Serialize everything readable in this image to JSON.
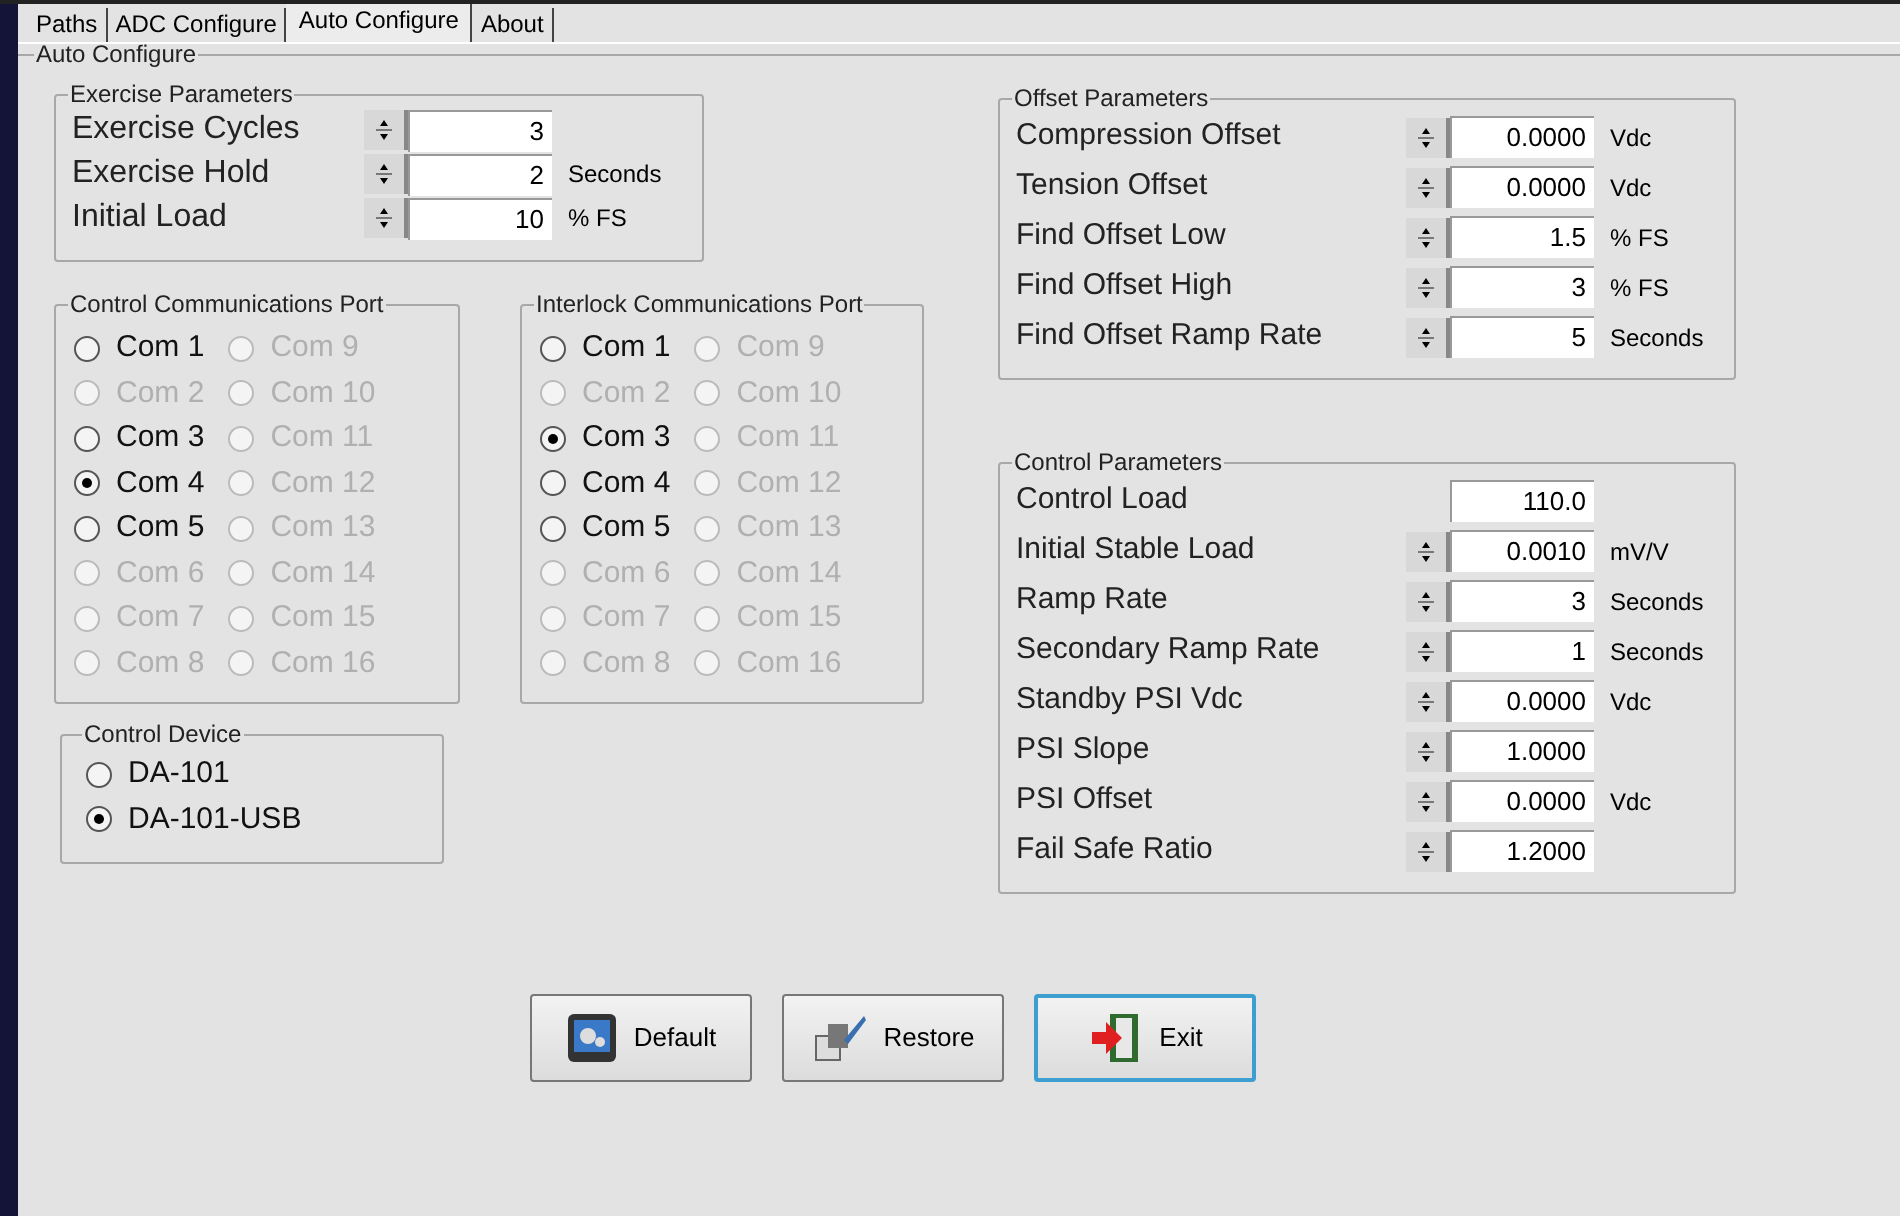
{
  "tabs": [
    {
      "label": "Paths",
      "selected": false
    },
    {
      "label": "ADC Configure",
      "selected": false
    },
    {
      "label": "Auto Configure",
      "selected": true
    },
    {
      "label": "About",
      "selected": false
    }
  ],
  "group_title": "Auto Configure",
  "exercise_parameters": {
    "title": "Exercise Parameters",
    "rows": [
      {
        "label": "Exercise Cycles",
        "value": "3",
        "kind": "spin"
      },
      {
        "label": "Exercise Hold",
        "value": "2",
        "unit": "Seconds",
        "kind": "spin"
      },
      {
        "label": "Initial Load",
        "value": "10",
        "unit": "% FS",
        "kind": "spin"
      }
    ]
  },
  "control_port": {
    "title": "Control Communications Port",
    "options": [
      {
        "label": "Com 1",
        "selected": false,
        "disabled": false
      },
      {
        "label": "Com 2",
        "selected": false,
        "disabled": true
      },
      {
        "label": "Com 3",
        "selected": false,
        "disabled": false
      },
      {
        "label": "Com 4",
        "selected": true,
        "disabled": false
      },
      {
        "label": "Com 5",
        "selected": false,
        "disabled": false
      },
      {
        "label": "Com 6",
        "selected": false,
        "disabled": true
      },
      {
        "label": "Com 7",
        "selected": false,
        "disabled": true
      },
      {
        "label": "Com 8",
        "selected": false,
        "disabled": true
      },
      {
        "label": "Com 9",
        "selected": false,
        "disabled": true
      },
      {
        "label": "Com 10",
        "selected": false,
        "disabled": true
      },
      {
        "label": "Com 11",
        "selected": false,
        "disabled": true
      },
      {
        "label": "Com 12",
        "selected": false,
        "disabled": true
      },
      {
        "label": "Com 13",
        "selected": false,
        "disabled": true
      },
      {
        "label": "Com 14",
        "selected": false,
        "disabled": true
      },
      {
        "label": "Com 15",
        "selected": false,
        "disabled": true
      },
      {
        "label": "Com 16",
        "selected": false,
        "disabled": true
      }
    ]
  },
  "interlock_port": {
    "title": "Interlock Communications Port",
    "options": [
      {
        "label": "Com 1",
        "selected": false,
        "disabled": false
      },
      {
        "label": "Com 2",
        "selected": false,
        "disabled": true
      },
      {
        "label": "Com 3",
        "selected": true,
        "disabled": false
      },
      {
        "label": "Com 4",
        "selected": false,
        "disabled": false
      },
      {
        "label": "Com 5",
        "selected": false,
        "disabled": false
      },
      {
        "label": "Com 6",
        "selected": false,
        "disabled": true
      },
      {
        "label": "Com 7",
        "selected": false,
        "disabled": true
      },
      {
        "label": "Com 8",
        "selected": false,
        "disabled": true
      },
      {
        "label": "Com 9",
        "selected": false,
        "disabled": true
      },
      {
        "label": "Com 10",
        "selected": false,
        "disabled": true
      },
      {
        "label": "Com 11",
        "selected": false,
        "disabled": true
      },
      {
        "label": "Com 12",
        "selected": false,
        "disabled": true
      },
      {
        "label": "Com 13",
        "selected": false,
        "disabled": true
      },
      {
        "label": "Com 14",
        "selected": false,
        "disabled": true
      },
      {
        "label": "Com 15",
        "selected": false,
        "disabled": true
      },
      {
        "label": "Com 16",
        "selected": false,
        "disabled": true
      }
    ]
  },
  "control_device": {
    "title": "Control Device",
    "options": [
      {
        "label": "DA-101",
        "selected": false,
        "disabled": false
      },
      {
        "label": "DA-101-USB",
        "selected": true,
        "disabled": false
      }
    ]
  },
  "offset_parameters": {
    "title": "Offset Parameters",
    "rows": [
      {
        "label": "Compression Offset",
        "value": "0.0000",
        "unit": "Vdc",
        "kind": "spin"
      },
      {
        "label": "Tension Offset",
        "value": "0.0000",
        "unit": "Vdc",
        "kind": "spin"
      },
      {
        "label": "Find Offset Low",
        "value": "1.5",
        "unit": "% FS",
        "kind": "spin"
      },
      {
        "label": "Find Offset High",
        "value": "3",
        "unit": "% FS",
        "kind": "spin"
      },
      {
        "label": "Find Offset Ramp Rate",
        "value": "5",
        "unit": "Seconds",
        "kind": "spin"
      }
    ]
  },
  "control_parameters": {
    "title": "Control Parameters",
    "rows": [
      {
        "label": "Control Load",
        "value": "110.0",
        "kind": "plain"
      },
      {
        "label": "Initial Stable Load",
        "value": "0.0010",
        "unit": "mV/V",
        "kind": "spin"
      },
      {
        "label": "Ramp Rate",
        "value": "3",
        "unit": "Seconds",
        "kind": "spin"
      },
      {
        "label": "Secondary Ramp Rate",
        "value": "1",
        "unit": "Seconds",
        "kind": "spin"
      },
      {
        "label": "Standby PSI Vdc",
        "value": "0.0000",
        "unit": "Vdc",
        "kind": "spin"
      },
      {
        "label": "PSI Slope",
        "value": "1.0000",
        "kind": "spin"
      },
      {
        "label": "PSI Offset",
        "value": "0.0000",
        "unit": "Vdc",
        "kind": "spin"
      },
      {
        "label": "Fail Safe Ratio",
        "value": "1.2000",
        "kind": "spin"
      }
    ]
  },
  "buttons": [
    {
      "label": "Default",
      "kind": "default",
      "focused": false
    },
    {
      "label": "Restore",
      "kind": "restore",
      "focused": false
    },
    {
      "label": "Exit",
      "kind": "exit",
      "focused": true
    }
  ]
}
